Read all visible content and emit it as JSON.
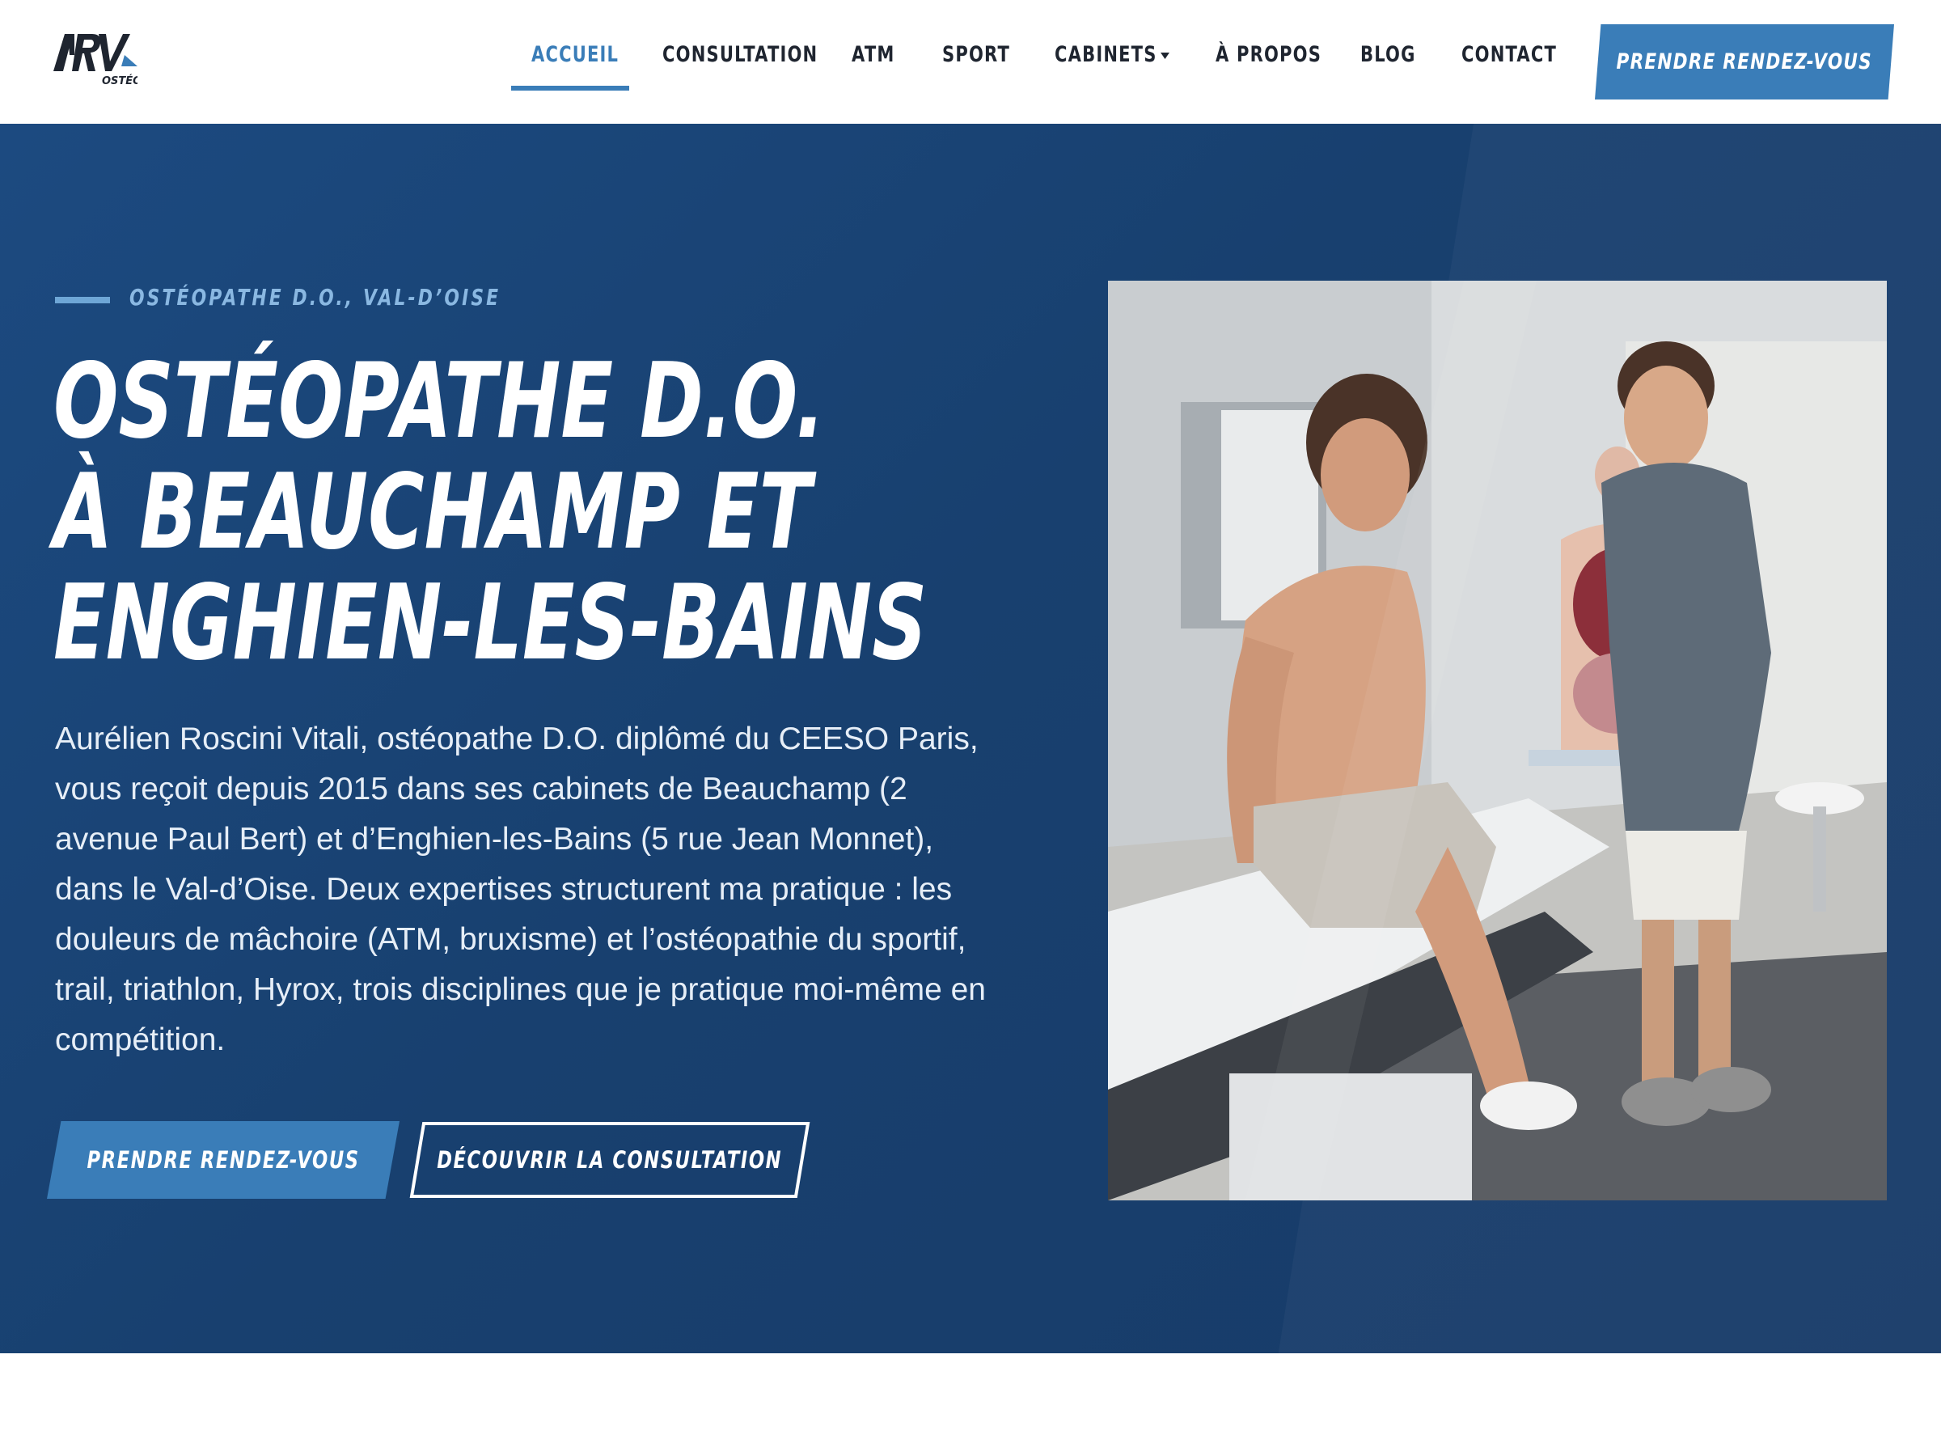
{
  "header": {
    "logo_text": "ARV",
    "logo_subtext": "OSTÉO",
    "nav": [
      {
        "label": "ACCUEIL",
        "active": true
      },
      {
        "label": "CONSULTATION",
        "active": false
      },
      {
        "label": "ATM",
        "active": false
      },
      {
        "label": "SPORT",
        "active": false
      },
      {
        "label": "CABINETS",
        "active": false,
        "has_dropdown": true
      },
      {
        "label": "À PROPOS",
        "active": false
      },
      {
        "label": "BLOG",
        "active": false
      },
      {
        "label": "CONTACT",
        "active": false
      }
    ],
    "cta_label": "PRENDRE RENDEZ-VOUS"
  },
  "hero": {
    "eyebrow": "OSTÉOPATHE D.O., VAL-D’OISE",
    "title_lines": [
      "OSTÉOPATHE D.O.",
      "À BEAUCHAMP ET",
      "ENGHIEN-LES-BAINS"
    ],
    "description": "Aurélien Roscini Vitali, ostéopathe D.O. diplômé du CEESO Paris, vous reçoit depuis 2015 dans ses cabinets de Beauchamp (2 avenue Paul Bert) et d’Enghien-les-Bains (5 rue Jean Monnet), dans le Val-d’Oise. Deux expertises structurent ma pratique : les douleurs de mâchoire (ATM, bruxisme) et l’ostéopathie du sportif, trail, triathlon, Hyrox, trois disciplines que je pratique moi-même en compétition.",
    "primary_button": "PRENDRE RENDEZ-VOUS",
    "secondary_button": "DÉCOUVRIR LA CONSULTATION"
  },
  "colors": {
    "accent": "#3a7db8",
    "hero_background": "#1a4476",
    "nav_text": "#1f2530",
    "eyebrow": "#8ab8e2"
  }
}
